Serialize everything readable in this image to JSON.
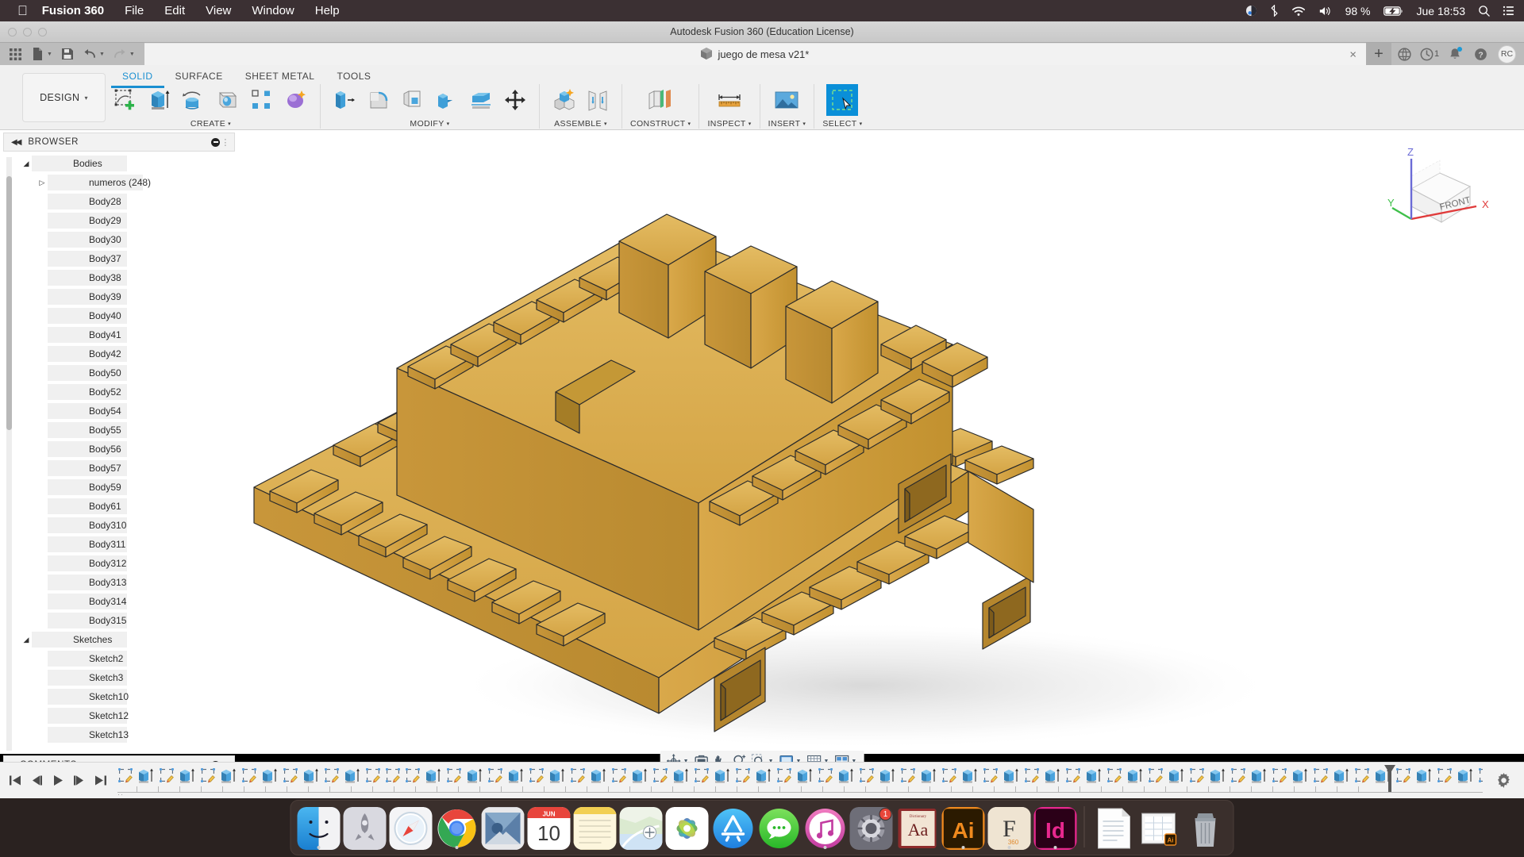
{
  "macbar": {
    "apple_icon": "apple-icon",
    "app_name": "Fusion 360",
    "menus": [
      "File",
      "Edit",
      "View",
      "Window",
      "Help"
    ],
    "battery_percent": "98 %",
    "clock": "Jue 18:53",
    "status_icons": [
      "siri-icon",
      "bluetooth-icon",
      "wifi-icon",
      "volume-icon",
      "battery-icon",
      "search-icon",
      "control-center-icon"
    ]
  },
  "titlebar": {
    "title": "Autodesk Fusion 360 (Education License)",
    "traffic_lights": [
      "close-button",
      "minimize-button",
      "maximize-button"
    ]
  },
  "quickaccess": {
    "left_icons": [
      "app-grid-icon",
      "new-file-icon",
      "save-icon",
      "undo-icon",
      "redo-icon"
    ],
    "document_tab": {
      "label": "juego de mesa v21*",
      "icon": "cube-icon",
      "close_label": "×"
    },
    "new_tab_label": "+",
    "right_icons": [
      "data-panel-icon",
      "job-status-icon",
      "notifications-icon",
      "help-icon"
    ],
    "job_count": "1",
    "avatar_initials": "RC"
  },
  "ribbon": {
    "workspace": {
      "label": "DESIGN",
      "caret": "▾"
    },
    "tabs": [
      {
        "label": "SOLID",
        "active": true
      },
      {
        "label": "SURFACE",
        "active": false
      },
      {
        "label": "SHEET METAL",
        "active": false
      },
      {
        "label": "TOOLS",
        "active": false
      }
    ],
    "panels": [
      {
        "label": "CREATE",
        "caret": "▾",
        "tools": [
          "create-sketch-icon",
          "extrude-icon",
          "revolve-icon",
          "sphere-icon",
          "pattern-icon",
          "form-icon"
        ]
      },
      {
        "label": "MODIFY",
        "caret": "▾",
        "tools": [
          "press-pull-icon",
          "fillet-icon",
          "shell-icon",
          "combine-icon",
          "split-face-icon",
          "move-copy-icon"
        ]
      },
      {
        "label": "ASSEMBLE",
        "caret": "▾",
        "tools": [
          "new-component-icon",
          "joint-icon"
        ]
      },
      {
        "label": "CONSTRUCT",
        "caret": "▾",
        "tools": [
          "offset-plane-icon"
        ]
      },
      {
        "label": "INSPECT",
        "caret": "▾",
        "tools": [
          "measure-icon"
        ]
      },
      {
        "label": "INSERT",
        "caret": "▾",
        "tools": [
          "insert-image-icon"
        ]
      },
      {
        "label": "SELECT",
        "caret": "▾",
        "tools": [
          "select-icon"
        ],
        "selected": true
      }
    ]
  },
  "browser": {
    "header": {
      "title": "BROWSER",
      "collapse_icon": "collapse-left-icon",
      "minimize_icon": "minimize-icon",
      "grip_icon": "grip-icon"
    },
    "nodes": [
      {
        "label": "Bodies",
        "indent": 0,
        "twist": "◢",
        "visible": true,
        "icon": "folder-icon",
        "type": "folder"
      },
      {
        "label": "numeros (248)",
        "indent": 1,
        "twist": "▷",
        "visible": false,
        "icon": "folder-icon",
        "type": "folder"
      },
      {
        "label": "Body28",
        "indent": 1,
        "twist": "",
        "visible": false,
        "icon": "body-icon",
        "type": "body"
      },
      {
        "label": "Body29",
        "indent": 1,
        "twist": "",
        "visible": true,
        "icon": "body-icon",
        "type": "body"
      },
      {
        "label": "Body30",
        "indent": 1,
        "twist": "",
        "visible": false,
        "icon": "body-icon",
        "type": "body"
      },
      {
        "label": "Body37",
        "indent": 1,
        "twist": "",
        "visible": false,
        "icon": "body-icon",
        "type": "body"
      },
      {
        "label": "Body38",
        "indent": 1,
        "twist": "",
        "visible": false,
        "icon": "body-icon",
        "type": "body"
      },
      {
        "label": "Body39",
        "indent": 1,
        "twist": "",
        "visible": false,
        "icon": "body-icon",
        "type": "body"
      },
      {
        "label": "Body40",
        "indent": 1,
        "twist": "",
        "visible": false,
        "icon": "body-icon",
        "type": "body"
      },
      {
        "label": "Body41",
        "indent": 1,
        "twist": "",
        "visible": false,
        "icon": "body-icon",
        "type": "body"
      },
      {
        "label": "Body42",
        "indent": 1,
        "twist": "",
        "visible": false,
        "icon": "body-icon",
        "type": "body"
      },
      {
        "label": "Body50",
        "indent": 1,
        "twist": "",
        "visible": false,
        "icon": "body-icon",
        "type": "body"
      },
      {
        "label": "Body52",
        "indent": 1,
        "twist": "",
        "visible": false,
        "icon": "body-icon",
        "type": "body"
      },
      {
        "label": "Body54",
        "indent": 1,
        "twist": "",
        "visible": false,
        "icon": "body-icon",
        "type": "body"
      },
      {
        "label": "Body55",
        "indent": 1,
        "twist": "",
        "visible": false,
        "icon": "body-icon",
        "type": "body"
      },
      {
        "label": "Body56",
        "indent": 1,
        "twist": "",
        "visible": false,
        "icon": "body-icon",
        "type": "body"
      },
      {
        "label": "Body57",
        "indent": 1,
        "twist": "",
        "visible": false,
        "icon": "body-icon",
        "type": "body"
      },
      {
        "label": "Body59",
        "indent": 1,
        "twist": "",
        "visible": false,
        "icon": "body-icon",
        "type": "body"
      },
      {
        "label": "Body61",
        "indent": 1,
        "twist": "",
        "visible": false,
        "icon": "body-icon",
        "type": "body"
      },
      {
        "label": "Body310",
        "indent": 1,
        "twist": "",
        "visible": false,
        "icon": "body-icon",
        "type": "body"
      },
      {
        "label": "Body311",
        "indent": 1,
        "twist": "",
        "visible": false,
        "icon": "body-icon",
        "type": "body"
      },
      {
        "label": "Body312",
        "indent": 1,
        "twist": "",
        "visible": false,
        "icon": "body-icon",
        "type": "body"
      },
      {
        "label": "Body313",
        "indent": 1,
        "twist": "",
        "visible": false,
        "icon": "body-icon",
        "type": "body"
      },
      {
        "label": "Body314",
        "indent": 1,
        "twist": "",
        "visible": false,
        "icon": "body-icon",
        "type": "body"
      },
      {
        "label": "Body315",
        "indent": 1,
        "twist": "",
        "visible": false,
        "icon": "body-icon",
        "type": "body"
      },
      {
        "label": "Sketches",
        "indent": 0,
        "twist": "◢",
        "visible": true,
        "icon": "folder-icon",
        "type": "folder"
      },
      {
        "label": "Sketch2",
        "indent": 1,
        "twist": "",
        "visible": false,
        "icon": "sketch-icon",
        "type": "sketch"
      },
      {
        "label": "Sketch3",
        "indent": 1,
        "twist": "",
        "visible": false,
        "icon": "sketch-icon",
        "type": "sketch"
      },
      {
        "label": "Sketch10",
        "indent": 1,
        "twist": "",
        "visible": false,
        "icon": "sketch-icon",
        "type": "sketch"
      },
      {
        "label": "Sketch12",
        "indent": 1,
        "twist": "",
        "visible": false,
        "icon": "sketch-icon",
        "type": "sketch"
      },
      {
        "label": "Sketch13",
        "indent": 1,
        "twist": "",
        "visible": false,
        "icon": "sketch-icon",
        "type": "sketch"
      }
    ]
  },
  "comments": {
    "title": "COMMENTS",
    "minimize_icon": "minimize-icon",
    "grip_icon": "grip-icon"
  },
  "viewcube": {
    "face_label": "FRONT",
    "axis_x": "X",
    "axis_y": "Y",
    "axis_z": "Z",
    "color_x": "#e03b3b",
    "color_y": "#3fc04a",
    "color_z": "#6b6bd6"
  },
  "navbar": {
    "buttons": [
      "orbit-icon",
      "look-at-icon",
      "pan-icon",
      "zoom-icon",
      "fit-icon",
      "display-settings-icon",
      "grid-snap-icon",
      "viewports-icon"
    ]
  },
  "timeline": {
    "controls": [
      "go-to-start-icon",
      "step-back-icon",
      "play-icon",
      "step-forward-icon",
      "go-to-end-icon"
    ],
    "nodes": [
      "sketch-icon",
      "extrude-icon",
      "sketch-icon",
      "extrude-icon",
      "sketch-icon",
      "extrude-icon",
      "sketch-icon",
      "extrude-icon",
      "sketch-icon",
      "extrude-icon",
      "sketch-icon",
      "extrude-icon",
      "sketch-icon",
      "sketch-icon",
      "sketch-icon",
      "extrude-icon",
      "sketch-icon",
      "extrude-icon",
      "sketch-icon",
      "extrude-icon",
      "sketch-icon",
      "extrude-icon",
      "sketch-icon",
      "extrude-icon",
      "sketch-icon",
      "extrude-icon",
      "sketch-icon",
      "extrude-icon",
      "sketch-icon",
      "extrude-icon",
      "sketch-icon",
      "extrude-icon",
      "sketch-icon",
      "extrude-icon",
      "sketch-icon",
      "extrude-icon",
      "sketch-icon",
      "extrude-icon",
      "sketch-icon",
      "extrude-icon",
      "sketch-icon",
      "extrude-icon",
      "sketch-icon",
      "extrude-icon",
      "sketch-icon",
      "extrude-icon",
      "sketch-icon",
      "extrude-icon",
      "sketch-icon",
      "extrude-icon",
      "sketch-icon",
      "extrude-icon",
      "sketch-icon",
      "extrude-icon",
      "sketch-icon",
      "extrude-icon",
      "sketch-icon",
      "extrude-icon",
      "sketch-icon",
      "extrude-icon",
      "sketch-icon",
      "extrude-icon",
      "sketch-icon",
      "extrude-icon",
      "sketch-icon",
      "extrude-icon",
      "sketch-icon",
      "extrude-icon",
      "sketch-icon",
      "extrude-icon",
      "sketch-icon",
      "extrude-icon",
      "sketch-icon",
      "extrude-icon",
      "sketch-icon",
      "extrude-icon"
    ],
    "settings_icon": "timeline-settings-icon",
    "playhead_icon": "playhead-marker"
  },
  "dock": {
    "items": [
      {
        "name": "finder",
        "label": "Finder",
        "running": true
      },
      {
        "name": "launchpad",
        "label": "Launchpad",
        "running": false
      },
      {
        "name": "safari",
        "label": "Safari",
        "running": false
      },
      {
        "name": "chrome",
        "label": "Google Chrome",
        "running": true
      },
      {
        "name": "mail",
        "label": "Mail",
        "running": false
      },
      {
        "name": "calendar",
        "label": "Calendar",
        "running": false,
        "month": "JUN",
        "day": "10"
      },
      {
        "name": "notes",
        "label": "Notes",
        "running": false
      },
      {
        "name": "maps",
        "label": "Maps",
        "running": false
      },
      {
        "name": "photos",
        "label": "Photos",
        "running": false
      },
      {
        "name": "appstore",
        "label": "App Store",
        "running": false
      },
      {
        "name": "messages",
        "label": "Messages",
        "running": false
      },
      {
        "name": "itunes",
        "label": "iTunes",
        "running": true
      },
      {
        "name": "systemprefs",
        "label": "System Preferences",
        "running": false,
        "badge": "1"
      },
      {
        "name": "dictionary",
        "label": "Dictionary",
        "running": false,
        "glyph": "Aa"
      },
      {
        "name": "illustrator",
        "label": "Adobe Illustrator",
        "running": true,
        "glyph": "Ai"
      },
      {
        "name": "fusion360",
        "label": "Fusion 360",
        "running": true,
        "glyph": "F",
        "sub": "360"
      },
      {
        "name": "indesign",
        "label": "Adobe InDesign",
        "running": true,
        "glyph": "Id"
      },
      {
        "name": "document",
        "label": "Document",
        "running": false
      },
      {
        "name": "spreadsheet",
        "label": "Spreadsheet",
        "running": false
      },
      {
        "name": "trash",
        "label": "Trash",
        "running": false
      }
    ]
  },
  "model": {
    "description": "3D board-game castle model",
    "body_color": "#d4a43f",
    "body_color_light": "#e0b55a",
    "body_color_dark": "#b8882c",
    "edge_color": "#2b2b2b"
  }
}
